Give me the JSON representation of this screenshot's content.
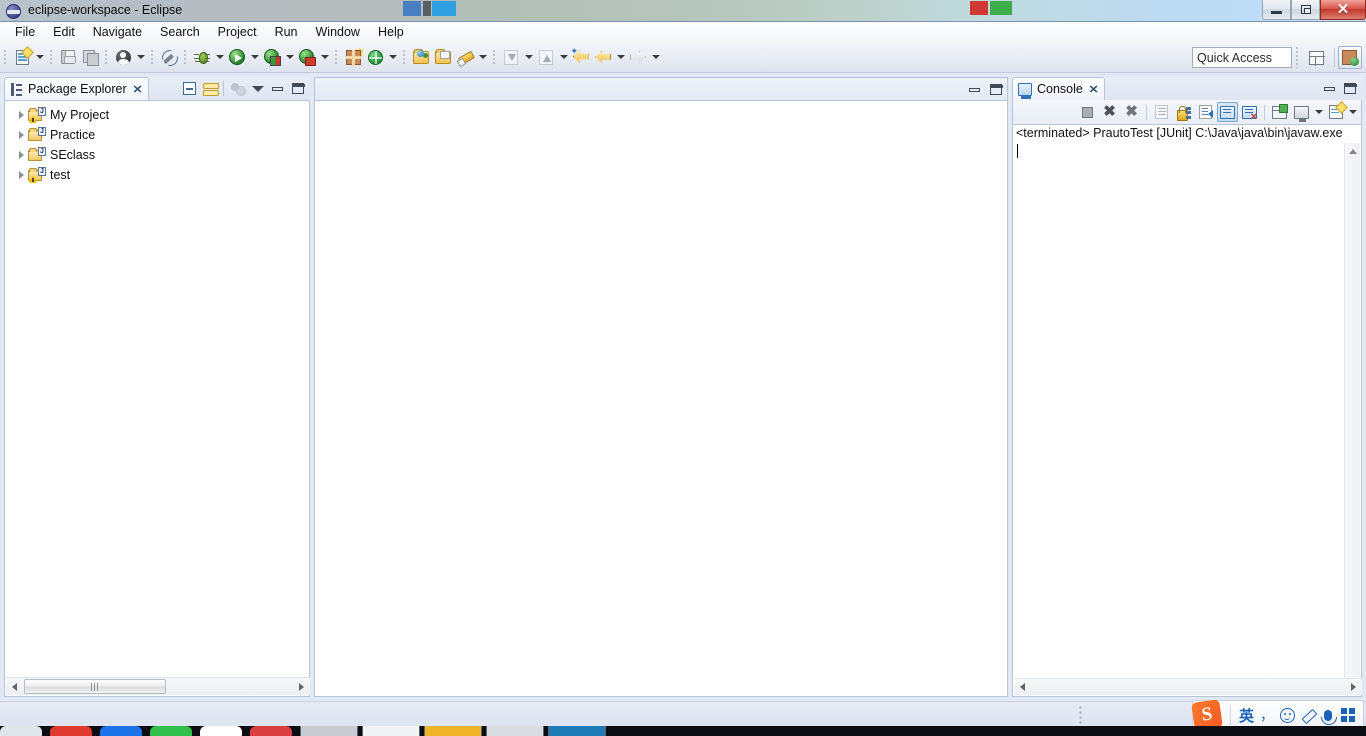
{
  "window": {
    "title": "eclipse-workspace - Eclipse",
    "app_icon": "eclipse-icon",
    "controls": {
      "minimize": "minimize-icon",
      "restore": "restore-icon",
      "close": "✕"
    }
  },
  "menubar": {
    "items": [
      {
        "label": "File"
      },
      {
        "label": "Edit"
      },
      {
        "label": "Navigate"
      },
      {
        "label": "Search"
      },
      {
        "label": "Project"
      },
      {
        "label": "Run"
      },
      {
        "label": "Window"
      },
      {
        "label": "Help"
      }
    ]
  },
  "toolbar": {
    "buttons": [
      {
        "name": "new-wizard",
        "icon": "new-document-icon",
        "has_dropdown": true,
        "enabled": true
      },
      {
        "name": "save",
        "icon": "save-icon",
        "has_dropdown": false,
        "enabled": false
      },
      {
        "name": "save-all",
        "icon": "save-all-icon",
        "has_dropdown": false,
        "enabled": false
      },
      {
        "name": "user-assistance",
        "icon": "person-icon",
        "has_dropdown": true,
        "enabled": true
      },
      {
        "name": "toggle-annotations",
        "icon": "pen-strikethrough-icon",
        "has_dropdown": false,
        "enabled": false
      },
      {
        "name": "debug",
        "icon": "bug-icon",
        "has_dropdown": true,
        "enabled": true
      },
      {
        "name": "run",
        "icon": "run-green-play-icon",
        "has_dropdown": true,
        "enabled": true
      },
      {
        "name": "run-external-tools",
        "icon": "run-external-icon",
        "has_dropdown": true,
        "enabled": true
      },
      {
        "name": "coverage",
        "icon": "coverage-icon",
        "has_dropdown": true,
        "enabled": true
      },
      {
        "name": "new-java-package",
        "icon": "package-new-icon",
        "has_dropdown": false,
        "enabled": true
      },
      {
        "name": "new-java-class",
        "icon": "java-class-globe-icon",
        "has_dropdown": true,
        "enabled": true
      },
      {
        "name": "open-type",
        "icon": "open-type-folder-icon",
        "has_dropdown": false,
        "enabled": true
      },
      {
        "name": "open-task",
        "icon": "open-task-folder-icon",
        "has_dropdown": false,
        "enabled": true
      },
      {
        "name": "mark-occurrences",
        "icon": "highlighter-icon",
        "has_dropdown": true,
        "enabled": true
      },
      {
        "name": "previous-annotation",
        "icon": "import-icon",
        "has_dropdown": true,
        "enabled": false
      },
      {
        "name": "next-annotation",
        "icon": "export-icon",
        "has_dropdown": true,
        "enabled": false
      },
      {
        "name": "last-edit-location",
        "icon": "back-arrow-star-icon",
        "has_dropdown": false,
        "enabled": true
      },
      {
        "name": "back",
        "icon": "back-arrow-icon",
        "has_dropdown": true,
        "enabled": true
      },
      {
        "name": "forward",
        "icon": "forward-arrow-icon",
        "has_dropdown": true,
        "enabled": false
      }
    ],
    "quick_access": {
      "name": "quick-access-field",
      "placeholder": "Quick Access",
      "value": "Quick Access"
    },
    "perspectives": [
      {
        "name": "open-perspective",
        "icon": "open-perspective-icon",
        "active": false
      },
      {
        "name": "java-perspective",
        "icon": "java-perspective-icon",
        "active": true
      }
    ]
  },
  "package_explorer": {
    "tab": {
      "label": "Package Explorer",
      "icon": "package-explorer-icon",
      "close": "✕",
      "active": true
    },
    "toolbar": [
      {
        "name": "collapse-all-button",
        "icon": "collapse-all-icon",
        "enabled": true
      },
      {
        "name": "link-with-editor-button",
        "icon": "link-editor-icon",
        "enabled": true
      },
      {
        "name": "focus-on-active-task-button",
        "icon": "focus-task-icon",
        "enabled": false
      },
      {
        "name": "view-menu-button",
        "icon": "chevron-down-icon",
        "enabled": true
      },
      {
        "name": "minimize-view-button",
        "icon": "minimize-icon",
        "enabled": true
      },
      {
        "name": "maximize-view-button",
        "icon": "maximize-icon",
        "enabled": true
      }
    ],
    "tree": [
      {
        "label": "My Project",
        "icon": "java-project-icon",
        "expanded": false,
        "warning": true
      },
      {
        "label": "Practice",
        "icon": "java-project-icon",
        "expanded": false,
        "warning": false
      },
      {
        "label": "SEclass",
        "icon": "java-project-icon",
        "expanded": false,
        "warning": false
      },
      {
        "label": "test",
        "icon": "java-project-icon",
        "expanded": false,
        "warning": true
      }
    ],
    "scrollbar": {
      "name": "horizontal-scrollbar",
      "left_arrow": "◀",
      "right_arrow": "▶"
    }
  },
  "editor": {
    "empty": true,
    "toolbar": [
      {
        "name": "minimize-editor-button",
        "icon": "minimize-icon"
      },
      {
        "name": "maximize-editor-button",
        "icon": "maximize-icon"
      }
    ]
  },
  "console": {
    "tab": {
      "label": "Console",
      "icon": "console-icon",
      "close": "✕",
      "active": true
    },
    "view_controls": [
      {
        "name": "minimize-view-button",
        "icon": "minimize-icon"
      },
      {
        "name": "maximize-view-button",
        "icon": "maximize-icon"
      }
    ],
    "toolbar": [
      {
        "name": "terminate-button",
        "icon": "terminate-square-icon",
        "enabled": false,
        "pressed": false
      },
      {
        "name": "remove-launch-button",
        "icon": "remove-x-icon",
        "enabled": true,
        "pressed": false
      },
      {
        "name": "remove-all-terminated-button",
        "icon": "remove-all-x-icon",
        "enabled": true,
        "pressed": false
      },
      {
        "name": "clear-console-button",
        "icon": "clear-console-icon",
        "enabled": false,
        "pressed": false
      },
      {
        "name": "scroll-lock-button",
        "icon": "lock-icon",
        "enabled": true,
        "pressed": false
      },
      {
        "name": "word-wrap-button",
        "icon": "word-wrap-icon",
        "enabled": true,
        "pressed": false
      },
      {
        "name": "show-console-on-output-button",
        "icon": "display-console-icon",
        "enabled": true,
        "pressed": true
      },
      {
        "name": "show-console-on-error-button",
        "icon": "display-console-error-icon",
        "enabled": true,
        "pressed": false
      },
      {
        "name": "pin-console-button",
        "icon": "pin-console-icon",
        "enabled": true,
        "pressed": false
      },
      {
        "name": "display-selected-console-button",
        "icon": "monitor-icon",
        "enabled": true,
        "has_dropdown": true,
        "pressed": false
      },
      {
        "name": "open-console-button",
        "icon": "new-console-icon",
        "enabled": true,
        "has_dropdown": true,
        "pressed": false
      }
    ],
    "status_line": "<terminated> PrautoTest [JUnit] C:\\Java\\java\\bin\\javaw.exe",
    "output": "",
    "scrollbars": {
      "vertical": "vertical-scrollbar",
      "horizontal": "horizontal-scrollbar"
    }
  },
  "statusbar": {
    "grip": "resize-grip"
  },
  "ime": {
    "logo": "S",
    "items": [
      {
        "name": "ime-language-mode",
        "glyph": "英"
      },
      {
        "name": "ime-punctuation-mode",
        "glyph": "，"
      },
      {
        "name": "ime-emoji-button",
        "glyph": "emoji-icon"
      },
      {
        "name": "ime-handwriting-button",
        "glyph": "pen-icon"
      },
      {
        "name": "ime-voice-input-button",
        "glyph": "microphone-icon"
      },
      {
        "name": "ime-toolbox-button",
        "glyph": "grid-icon"
      }
    ]
  },
  "taskbar": {
    "items": [
      {
        "name": "taskbar-item-1",
        "color": "#dfe6ec"
      },
      {
        "name": "taskbar-item-2",
        "color": "#e03a2f"
      },
      {
        "name": "taskbar-item-3",
        "color": "#1a73e8"
      },
      {
        "name": "taskbar-item-4",
        "color": "#2fbf4a"
      },
      {
        "name": "taskbar-item-5",
        "color": "#ffffff"
      },
      {
        "name": "taskbar-item-6",
        "color": "#d93f3f"
      },
      {
        "name": "taskbar-item-7",
        "color": "#c8ccd0"
      },
      {
        "name": "taskbar-item-8",
        "color": "#f2f3f5"
      },
      {
        "name": "taskbar-item-9",
        "color": "#f0b429"
      },
      {
        "name": "taskbar-item-10",
        "color": "#d9dde1"
      },
      {
        "name": "taskbar-item-11",
        "color": "#1f7ab8"
      }
    ]
  }
}
